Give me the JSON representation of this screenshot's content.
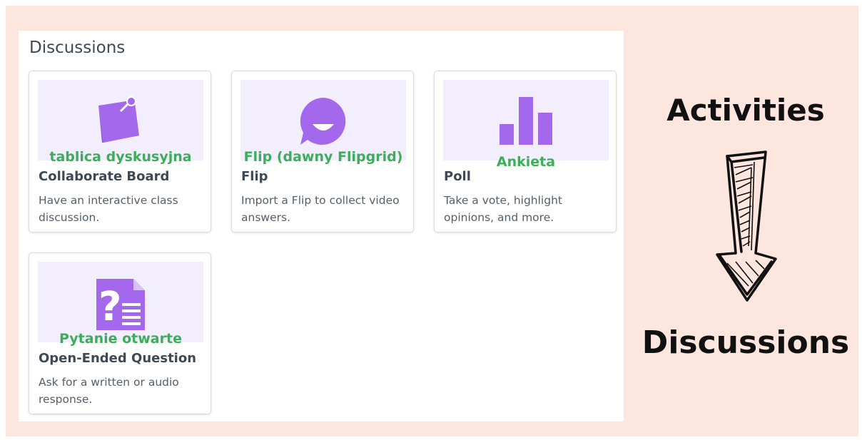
{
  "panel": {
    "title": "Discussions",
    "cards": [
      {
        "icon": "sticky-note-pin-icon",
        "overlay": "tablica dyskusyjna",
        "name": "Collaborate Board",
        "description": "Have an interactive class discussion."
      },
      {
        "icon": "flip-logo-icon",
        "overlay": "Flip (dawny Flipgrid)",
        "name": "Flip",
        "description": "Import a Flip to collect video answers."
      },
      {
        "icon": "bar-chart-icon",
        "overlay": "Ankieta",
        "name": "Poll",
        "description": "Take a vote, highlight opinions, and more."
      },
      {
        "icon": "question-document-icon",
        "overlay": "Pytanie otwarte",
        "name": "Open-Ended Question",
        "description": "Ask for a written or audio response."
      }
    ]
  },
  "annotation": {
    "from": "Activities",
    "to": "Discussions",
    "arrow_icon": "hand-drawn-down-arrow-icon"
  },
  "colors": {
    "backdrop": "#fde6de",
    "thumb": "#f3eefd",
    "icon": "#a468ec",
    "overlay_text": "#3cae5a",
    "heading": "#3e4955"
  }
}
